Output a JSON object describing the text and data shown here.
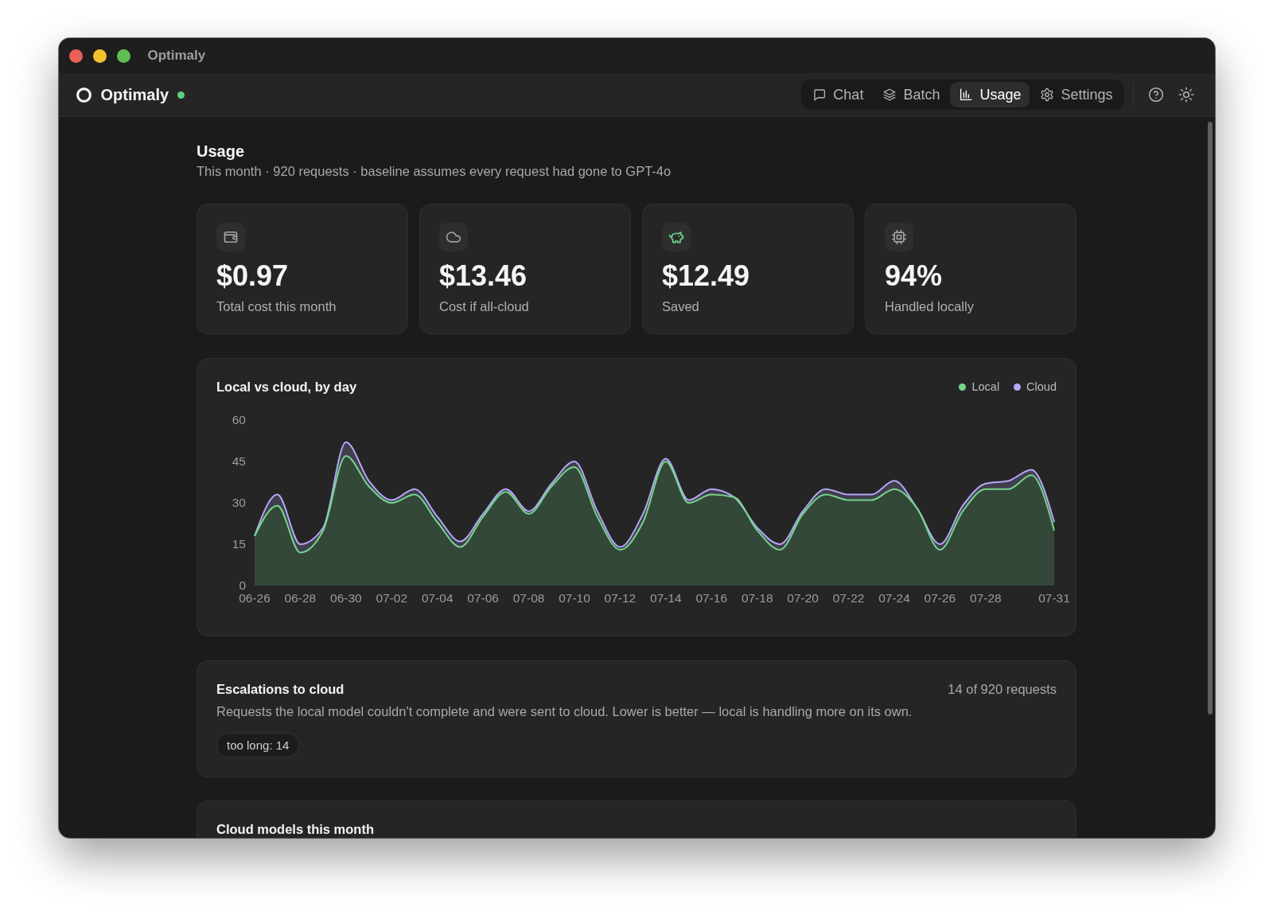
{
  "window": {
    "title": "Optimaly"
  },
  "header": {
    "app_name": "Optimaly",
    "online": true,
    "tabs": [
      {
        "label": "Chat",
        "selected": false
      },
      {
        "label": "Batch",
        "selected": false
      },
      {
        "label": "Usage",
        "selected": true
      },
      {
        "label": "Settings",
        "selected": false
      }
    ]
  },
  "page": {
    "title": "Usage",
    "subtitle": "This month · 920 requests · baseline assumes every request had gone to GPT-4o"
  },
  "stats": [
    {
      "value": "$0.97",
      "label": "Total cost this month",
      "accent": false
    },
    {
      "value": "$13.46",
      "label": "Cost if all-cloud",
      "accent": false
    },
    {
      "value": "$12.49",
      "label": "Saved",
      "accent": true
    },
    {
      "value": "94%",
      "label": "Handled locally",
      "accent": false
    }
  ],
  "chart": {
    "chart_data": {
      "type": "area",
      "title": "Local vs cloud, by day",
      "stacked": true,
      "ylim": [
        0,
        60
      ],
      "yticks": [
        0,
        15,
        30,
        45,
        60
      ],
      "categories": [
        "06-26",
        null,
        "06-28",
        null,
        "06-30",
        null,
        "07-02",
        null,
        "07-04",
        null,
        "07-06",
        null,
        "07-08",
        null,
        "07-10",
        null,
        "07-12",
        null,
        "07-14",
        null,
        "07-16",
        null,
        "07-18",
        null,
        "07-20",
        null,
        "07-22",
        null,
        "07-24",
        null,
        "07-26",
        null,
        "07-28",
        null,
        null,
        "07-31"
      ],
      "series": [
        {
          "name": "Local",
          "color": "#74d68a",
          "values": [
            18,
            29,
            12,
            20,
            47,
            36,
            30,
            33,
            23,
            14,
            25,
            34,
            26,
            36,
            43,
            25,
            13,
            23,
            45,
            30,
            33,
            32,
            20,
            13,
            26,
            33,
            31,
            31,
            35,
            28,
            13,
            27,
            35,
            35,
            40,
            20
          ]
        },
        {
          "name": "Cloud",
          "color": "#b4a7f7",
          "values": [
            0,
            4,
            3,
            1,
            5,
            2,
            1,
            2,
            2,
            2,
            1,
            1,
            1,
            1,
            2,
            2,
            1,
            3,
            1,
            1,
            2,
            0,
            1,
            2,
            1,
            2,
            2,
            2,
            3,
            0,
            2,
            2,
            2,
            3,
            2,
            3
          ]
        }
      ]
    }
  },
  "escalations": {
    "title": "Escalations to cloud",
    "count": "14 of 920 requests",
    "description": "Requests the local model couldn't complete and were sent to cloud. Lower is better — local is handling more on its own.",
    "reasons": [
      {
        "label": "too long: 14"
      }
    ]
  },
  "cloud_models": {
    "title": "Cloud models this month"
  }
}
